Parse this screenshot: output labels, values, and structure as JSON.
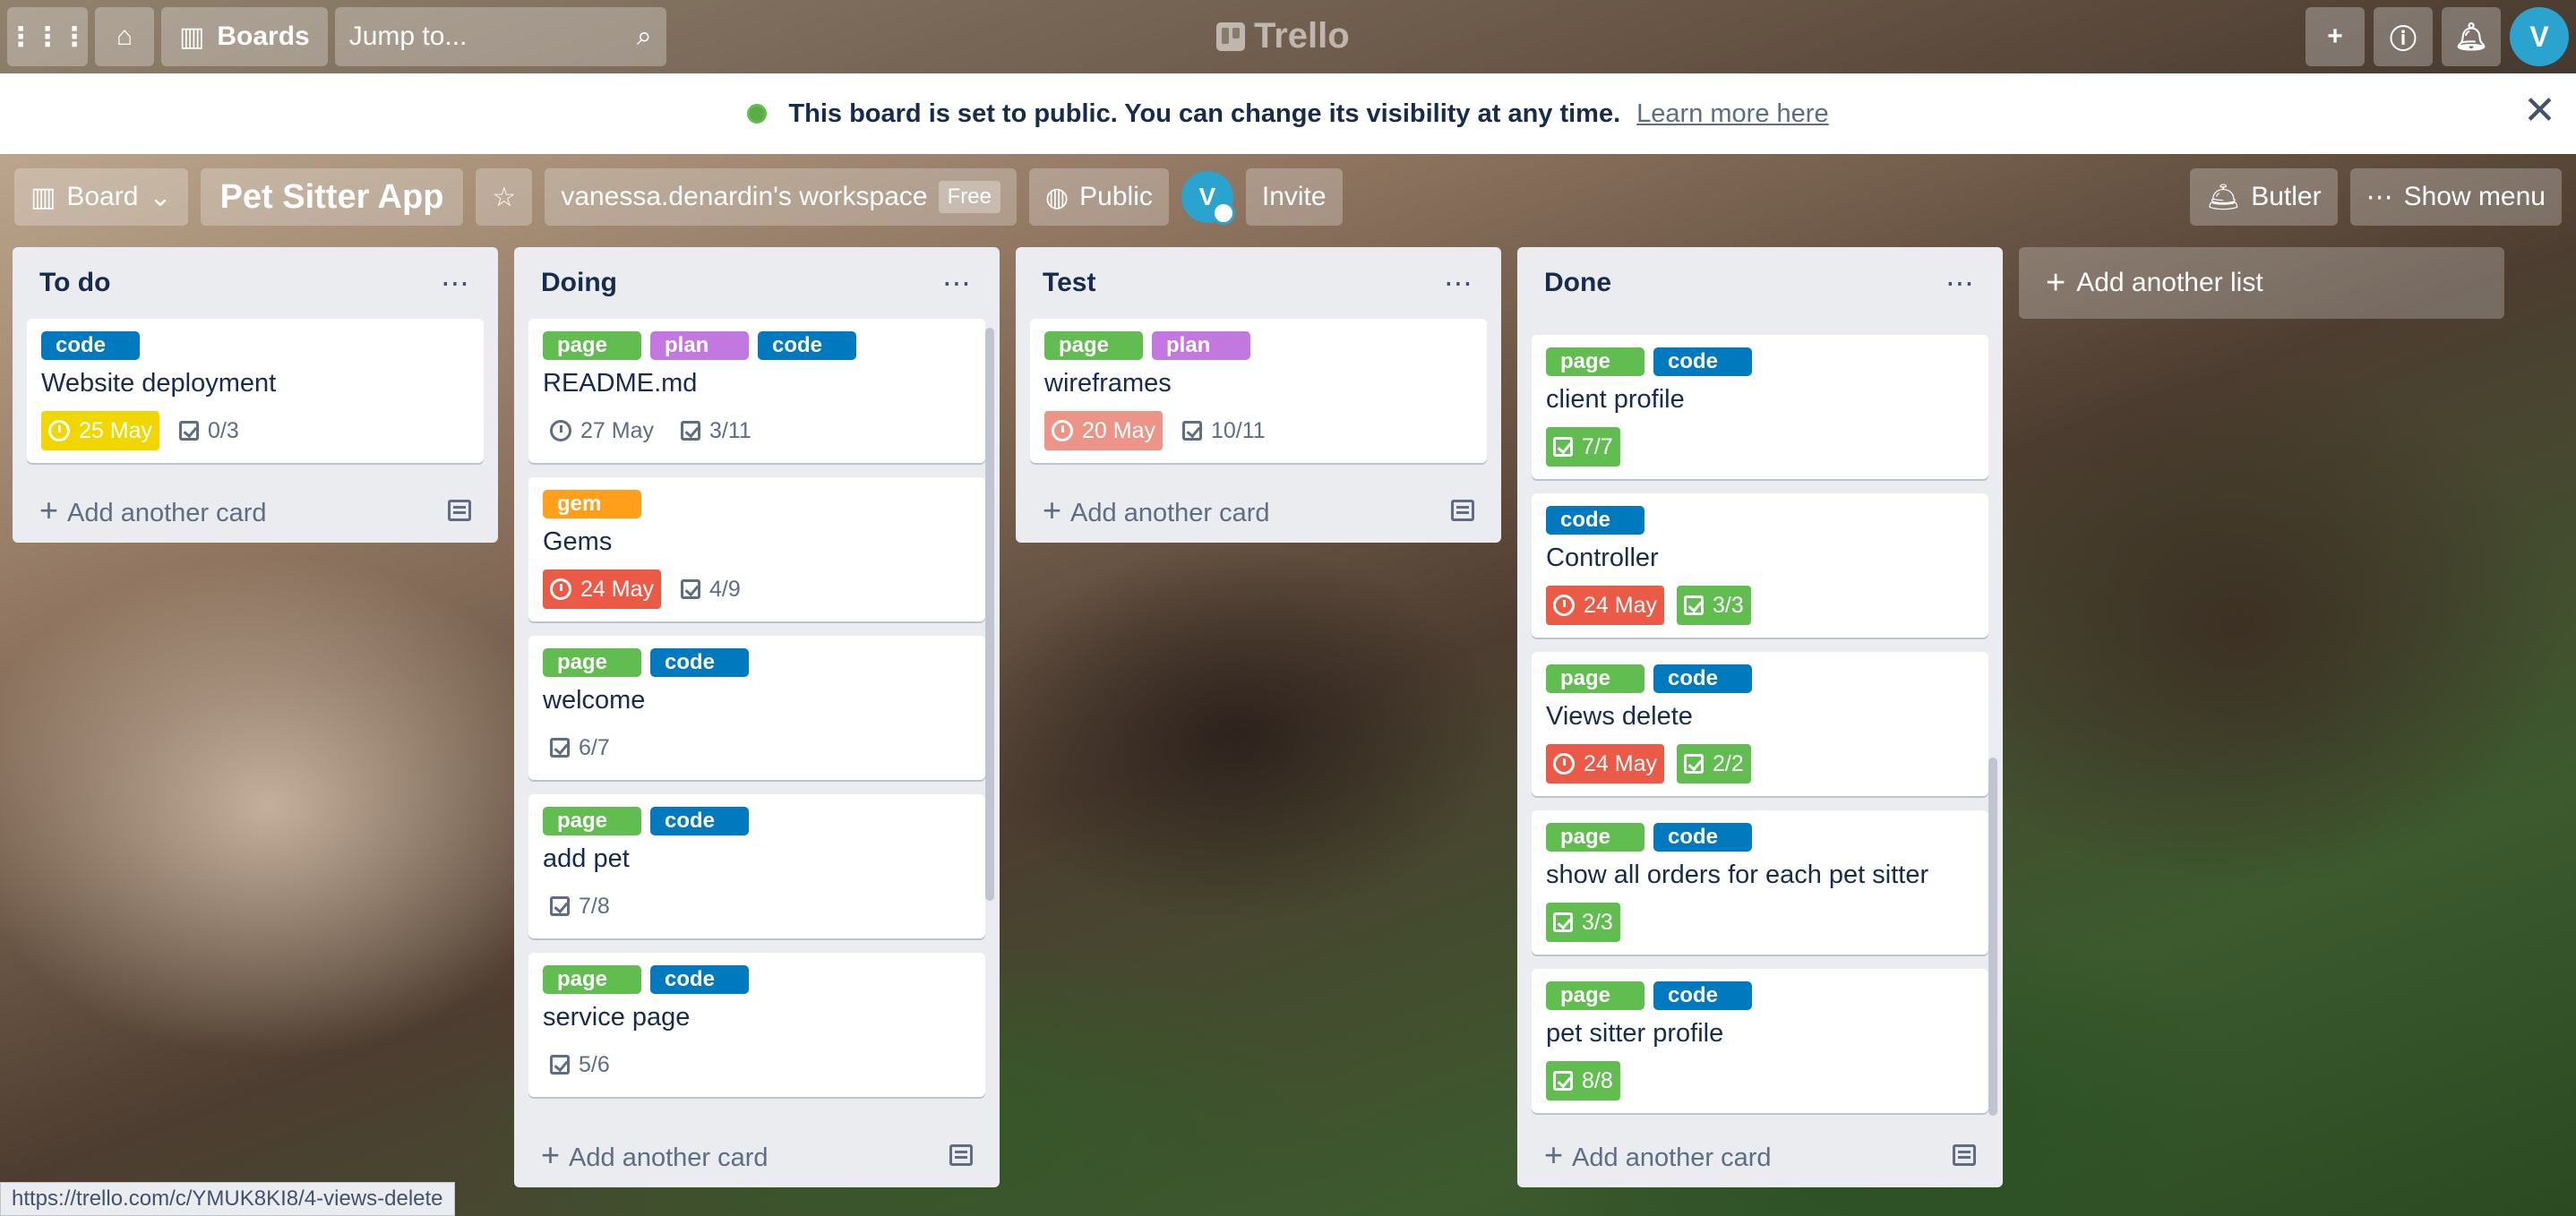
{
  "topnav": {
    "boards_label": "Boards",
    "search_placeholder": "Jump to...",
    "logo": "Trello",
    "avatar_initial": "V"
  },
  "banner": {
    "message": "This board is set to public. You can change its visibility at any time.",
    "link": "Learn more here"
  },
  "header": {
    "view_label": "Board",
    "board_title": "Pet Sitter App",
    "workspace": "vanessa.denardin's workspace",
    "workspace_badge": "Free",
    "visibility": "Public",
    "member_initial": "V",
    "invite": "Invite",
    "butler": "Butler",
    "show_menu": "Show menu"
  },
  "colors": {
    "green": "#61bd4f",
    "purple": "#c377e0",
    "blue": "#0079bf",
    "orange": "#ff9f1a",
    "yellow": "#f2d600",
    "red": "#eb5a46"
  },
  "add_card": "Add another card",
  "add_list": "Add another list",
  "lists": [
    {
      "title": "To do",
      "cards": [
        {
          "labels": [
            "code"
          ],
          "title": "Website deployment",
          "due": "25 May",
          "checklist": "0/3"
        }
      ]
    },
    {
      "title": "Doing",
      "cards": [
        {
          "labels": [
            "page",
            "plan",
            "code"
          ],
          "title": "README.md",
          "due": "27 May",
          "checklist": "3/11"
        },
        {
          "labels": [
            "gem"
          ],
          "title": "Gems",
          "due": "24 May",
          "checklist": "4/9"
        },
        {
          "labels": [
            "page",
            "code"
          ],
          "title": "welcome",
          "checklist": "6/7"
        },
        {
          "labels": [
            "page",
            "code"
          ],
          "title": "add pet",
          "checklist": "7/8"
        },
        {
          "labels": [
            "page",
            "code"
          ],
          "title": "service page",
          "checklist": "5/6"
        }
      ]
    },
    {
      "title": "Test",
      "cards": [
        {
          "labels": [
            "page",
            "plan"
          ],
          "title": "wireframes",
          "due": "20 May",
          "checklist": "10/11"
        }
      ]
    },
    {
      "title": "Done",
      "cards": [
        {
          "labels": [
            "page",
            "code"
          ],
          "title": "client profile",
          "checklist": "7/7"
        },
        {
          "labels": [
            "code"
          ],
          "title": "Controller",
          "due": "24 May",
          "checklist": "3/3"
        },
        {
          "labels": [
            "page",
            "code"
          ],
          "title": "Views delete",
          "due": "24 May",
          "checklist": "2/2"
        },
        {
          "labels": [
            "page",
            "code"
          ],
          "title": "show all orders for each pet sitter",
          "checklist": "3/3"
        },
        {
          "labels": [
            "page",
            "code"
          ],
          "title": "pet sitter profile",
          "checklist": "8/8"
        }
      ]
    }
  ],
  "status_url": "https://trello.com/c/YMUK8KI8/4-views-delete"
}
